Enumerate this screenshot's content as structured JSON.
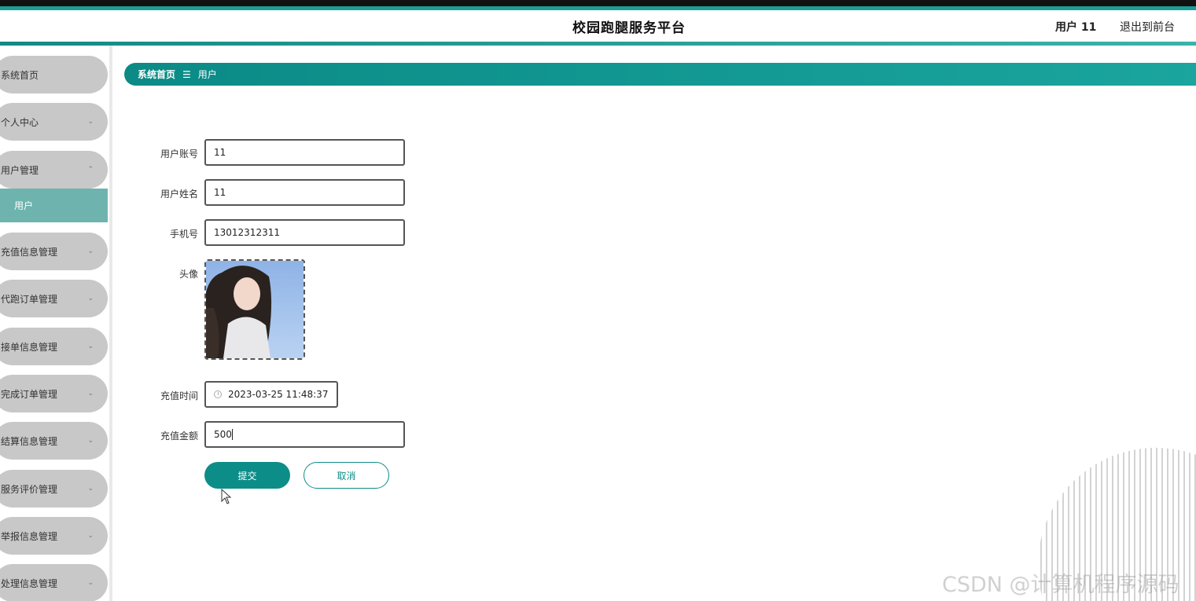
{
  "header": {
    "title": "校园跑腿服务平台",
    "user": "用户 11",
    "logout": "退出到前台"
  },
  "sidebar": {
    "items": [
      {
        "label": "系统首页"
      },
      {
        "label": "个人中心"
      },
      {
        "label": "用户管理"
      },
      {
        "label": "充值信息管理"
      },
      {
        "label": "代跑订单管理"
      },
      {
        "label": "接单信息管理"
      },
      {
        "label": "完成订单管理"
      },
      {
        "label": "结算信息管理"
      },
      {
        "label": "服务评价管理"
      },
      {
        "label": "举报信息管理"
      },
      {
        "label": "处理信息管理"
      }
    ],
    "sub_item": "用户"
  },
  "breadcrumb": {
    "home": "系统首页",
    "separator": "☰",
    "current": "用户"
  },
  "form": {
    "account_label": "用户账号",
    "account_value": "11",
    "name_label": "用户姓名",
    "name_value": "11",
    "phone_label": "手机号",
    "phone_value": "13012312311",
    "avatar_label": "头像",
    "time_label": "充值时间",
    "time_value": "2023-03-25 11:48:37",
    "amount_label": "充值金额",
    "amount_value": "500",
    "submit": "提交",
    "cancel": "取消"
  },
  "watermark": "CSDN @计算机程序源码",
  "colors": {
    "accent": "#0d8d88",
    "sidebar_item": "#c8c8c8",
    "sidebar_active": "#6fb3ae"
  }
}
